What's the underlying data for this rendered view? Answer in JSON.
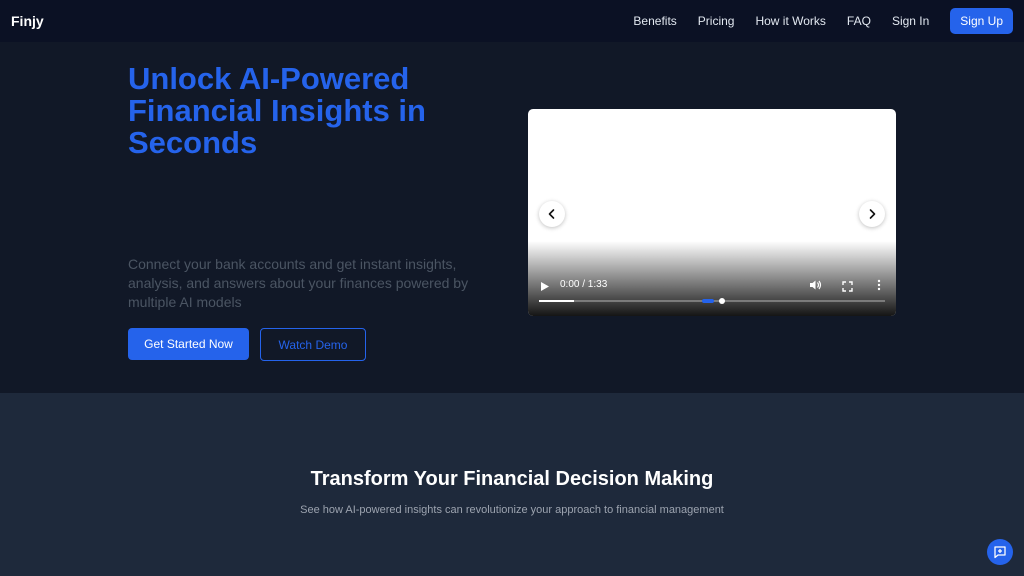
{
  "nav": {
    "brand": "Finjy",
    "links": [
      "Benefits",
      "Pricing",
      "How it Works",
      "FAQ",
      "Sign In"
    ],
    "signup": "Sign Up"
  },
  "hero": {
    "title": "Unlock AI-Powered Financial Insights in Seconds",
    "subtitle": "Connect your bank accounts and get instant insights, analysis, and answers about your finances powered by multiple AI models",
    "primary_button": "Get Started Now",
    "secondary_button": "Watch Demo"
  },
  "video": {
    "time": "0:00 / 1:33",
    "progress_buffered": 0.1,
    "progress_played": 0.52
  },
  "section": {
    "title": "Transform Your Financial Decision Making",
    "subtitle": "See how AI-powered insights can revolutionize your approach to financial management"
  },
  "icons": {
    "play": "play-icon",
    "volume": "volume-icon",
    "fullscreen": "fullscreen-icon",
    "more": "more-vert-icon",
    "prev": "chevron-left-icon",
    "next": "chevron-right-icon",
    "chat": "chat-add-icon"
  },
  "colors": {
    "accent": "#2563eb",
    "navbar": "#0b1124",
    "hero_bg": "#111827",
    "section_bg": "#1e293b"
  }
}
